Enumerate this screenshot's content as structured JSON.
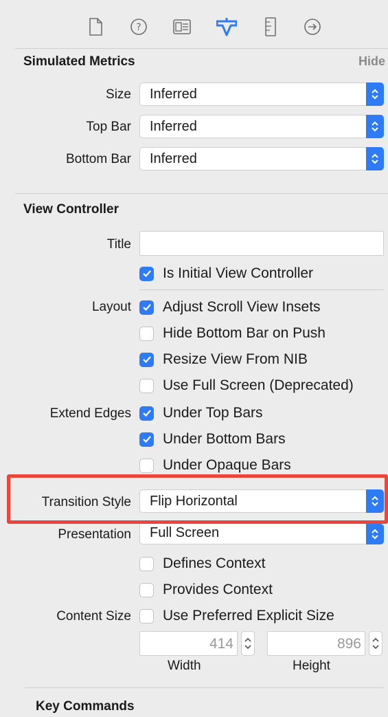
{
  "toolbar": {
    "icons": [
      "file-icon",
      "help-icon",
      "identity-icon",
      "attributes-icon",
      "size-icon",
      "connections-icon"
    ],
    "active": "attributes-icon",
    "accent": "#2d7cf5"
  },
  "simulated_metrics": {
    "title": "Simulated Metrics",
    "hide_label": "Hide",
    "size": {
      "label": "Size",
      "value": "Inferred"
    },
    "top_bar": {
      "label": "Top Bar",
      "value": "Inferred"
    },
    "bottom_bar": {
      "label": "Bottom Bar",
      "value": "Inferred"
    }
  },
  "view_controller": {
    "title": "View Controller",
    "title_label": "Title",
    "title_value": "",
    "is_initial": {
      "label": "Is Initial View Controller",
      "checked": true
    },
    "layout_label": "Layout",
    "layout": [
      {
        "label": "Adjust Scroll View Insets",
        "checked": true
      },
      {
        "label": "Hide Bottom Bar on Push",
        "checked": false
      },
      {
        "label": "Resize View From NIB",
        "checked": true
      },
      {
        "label": "Use Full Screen (Deprecated)",
        "checked": false
      }
    ],
    "extend_edges_label": "Extend Edges",
    "extend_edges": [
      {
        "label": "Under Top Bars",
        "checked": true
      },
      {
        "label": "Under Bottom Bars",
        "checked": true
      },
      {
        "label": "Under Opaque Bars",
        "checked": false
      }
    ],
    "transition_style": {
      "label": "Transition Style",
      "value": "Flip Horizontal"
    },
    "presentation": {
      "label": "Presentation",
      "value": "Full Screen"
    },
    "defines_context": {
      "label": "Defines Context",
      "checked": false
    },
    "provides_context": {
      "label": "Provides Context",
      "checked": false
    },
    "content_size_label": "Content Size",
    "use_preferred": {
      "label": "Use Preferred Explicit Size",
      "checked": false
    },
    "width": {
      "value": "414",
      "label": "Width"
    },
    "height": {
      "value": "896",
      "label": "Height"
    }
  },
  "key_commands": {
    "title": "Key Commands"
  },
  "highlight_color": "#e8483c"
}
